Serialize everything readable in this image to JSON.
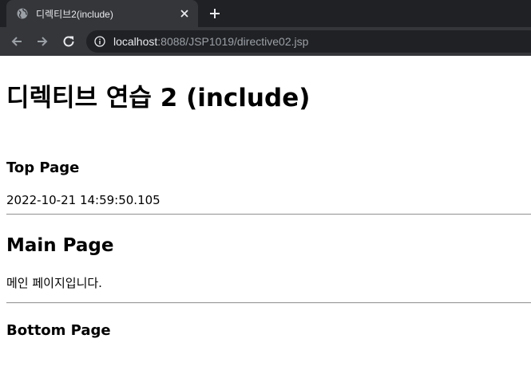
{
  "browser": {
    "tab_title": "디렉티브2(include)",
    "url_host": "localhost",
    "url_rest": ":8088/JSP1019/directive02.jsp",
    "icons": {
      "favicon": "globe-icon",
      "close": "close-icon",
      "new_tab": "plus-icon",
      "back": "arrow-left-icon",
      "forward": "arrow-right-icon",
      "reload": "reload-icon",
      "site_info": "info-icon"
    }
  },
  "page": {
    "title": "디렉티브 연습 2 (include)",
    "top_heading": "Top Page",
    "timestamp": "2022-10-21 14:59:50.105",
    "main_heading": "Main Page",
    "main_text": "메인 페이지입니다.",
    "bottom_heading": "Bottom Page"
  }
}
